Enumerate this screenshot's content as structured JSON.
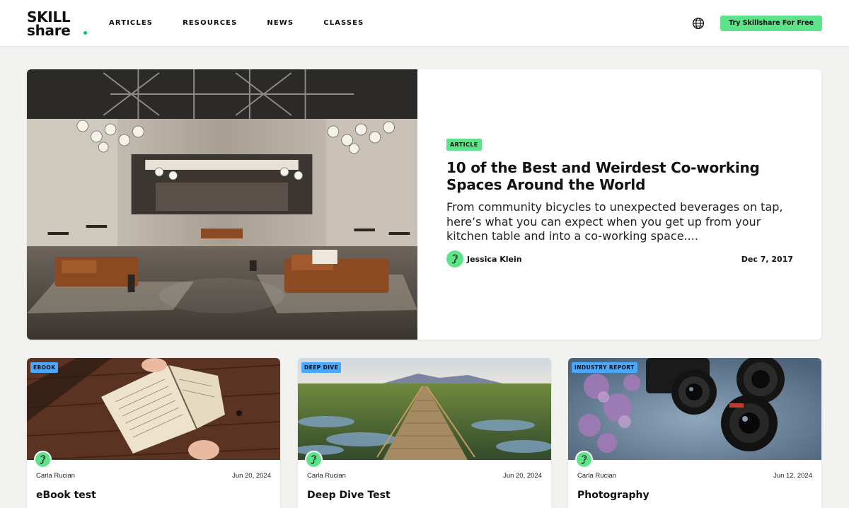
{
  "header": {
    "logo_line1": "SKILL",
    "logo_line2": "share",
    "nav": [
      "ARTICLES",
      "RESOURCES",
      "NEWS",
      "CLASSES"
    ],
    "cta_label": "Try Skillshare For Free",
    "globe_icon": "globe-icon"
  },
  "colors": {
    "brand_green": "#5ee38b",
    "tag_blue": "#4aa8ff",
    "page_bg": "#f2f2f0"
  },
  "hero": {
    "tag": "ARTICLE",
    "title": "10 of the Best and Weirdest Co-working Spaces Around the World",
    "excerpt": "From community bicycles to unexpected beverages on tap, here’s what you can expect when you get up from your kitchen table and into a co-working space....",
    "author": "Jessica Klein",
    "date": "Dec 7, 2017",
    "image_icon": "coworking-hall-image"
  },
  "cards": [
    {
      "tag": "EBOOK",
      "author": "Carla Rucian",
      "date": "Jun 20, 2024",
      "title": "eBook test",
      "image_icon": "open-book-image"
    },
    {
      "tag": "DEEP DIVE",
      "author": "Carla Rucian",
      "date": "Jun 20, 2024",
      "title": "Deep Dive Test",
      "image_icon": "boardwalk-landscape-image"
    },
    {
      "tag": "INDUSTRY REPORT",
      "author": "Carla Rucian",
      "date": "Jun 12, 2024",
      "title": "Photography",
      "image_icon": "cameras-image"
    }
  ]
}
